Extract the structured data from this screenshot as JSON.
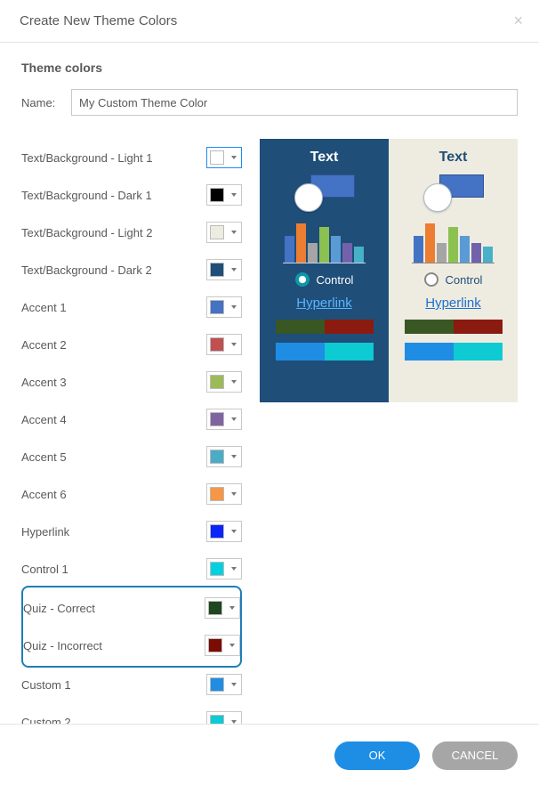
{
  "title": "Create New Theme Colors",
  "section_title": "Theme colors",
  "name_label": "Name:",
  "name_value": "My Custom Theme Color",
  "rows": [
    {
      "label": "Text/Background - Light 1",
      "color": "#ffffff",
      "selected": true
    },
    {
      "label": "Text/Background - Dark 1",
      "color": "#000000"
    },
    {
      "label": "Text/Background - Light 2",
      "color": "#eeece0"
    },
    {
      "label": "Text/Background - Dark 2",
      "color": "#1f4e79"
    },
    {
      "label": "Accent 1",
      "color": "#4472c4"
    },
    {
      "label": "Accent 2",
      "color": "#c05050"
    },
    {
      "label": "Accent 3",
      "color": "#9bbb59"
    },
    {
      "label": "Accent 4",
      "color": "#8064a2"
    },
    {
      "label": "Accent 5",
      "color": "#4bacc6"
    },
    {
      "label": "Accent 6",
      "color": "#f79646"
    },
    {
      "label": "Hyperlink",
      "color": "#0b24fb"
    },
    {
      "label": "Control 1",
      "color": "#00d1e0"
    },
    {
      "label": "Quiz - Correct",
      "color": "#1e4620"
    },
    {
      "label": "Quiz - Incorrect",
      "color": "#7a0c04"
    },
    {
      "label": "Custom 1",
      "color": "#1f8de4"
    },
    {
      "label": "Custom 2",
      "color": "#0ecad2"
    }
  ],
  "preview": {
    "text_label": "Text",
    "control_label": "Control",
    "hyperlink_label": "Hyperlink"
  },
  "buttons": {
    "ok": "OK",
    "cancel": "CANCEL"
  }
}
